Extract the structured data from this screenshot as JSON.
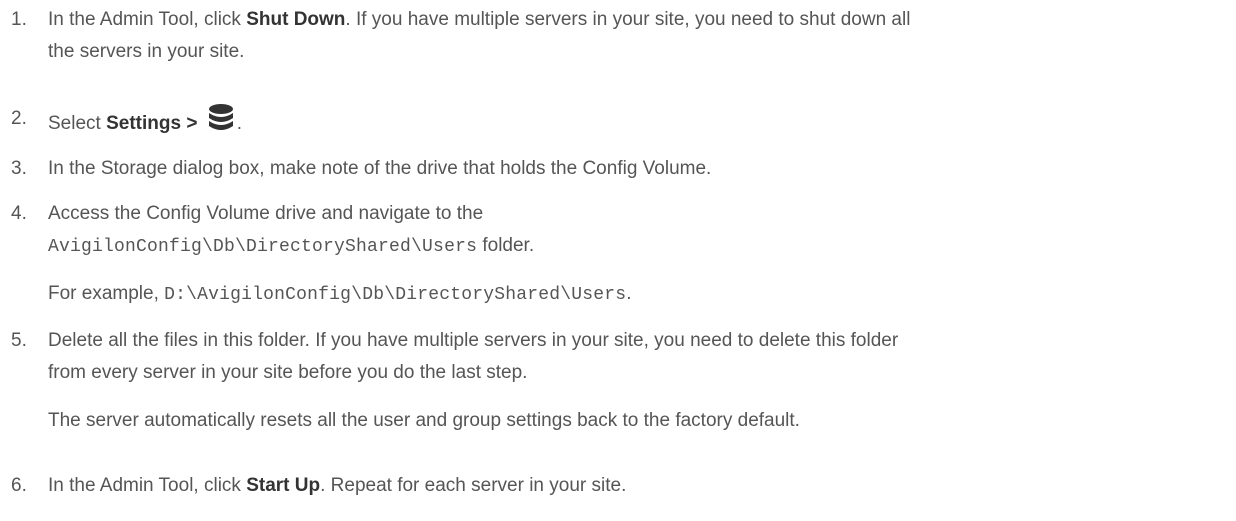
{
  "steps": [
    {
      "num": "1.",
      "pre": "In the Admin Tool, click ",
      "bold": "Shut Down",
      "post": ". If you have multiple servers in your site, you need to shut down all",
      "line2": "the servers in your site."
    },
    {
      "num": "2.",
      "pre": "Select ",
      "bold": "Settings",
      "post": " > ",
      "icon": "database-icon",
      "end": "."
    },
    {
      "num": "3.",
      "text": "In the Storage dialog box, make note of the drive that holds the Config Volume."
    },
    {
      "num": "4.",
      "text": "Access the Config Volume drive and navigate to the",
      "path": "AvigilonConfig\\Db\\DirectoryShared\\Users",
      "path_suffix": " folder.",
      "example_pre": "For example, ",
      "example_path": "D:\\AvigilonConfig\\Db\\DirectoryShared\\Users",
      "example_post": "."
    },
    {
      "num": "5.",
      "line1": "Delete all the files in this folder. If you have multiple servers in your site, you need to delete this folder",
      "line2": "from every server in your site before you do the last step.",
      "note": "The server automatically resets all the user and group settings back to the factory default."
    },
    {
      "num": "6.",
      "pre": "In the Admin Tool, click ",
      "bold": "Start Up",
      "post": ". Repeat for each server in your site."
    }
  ]
}
